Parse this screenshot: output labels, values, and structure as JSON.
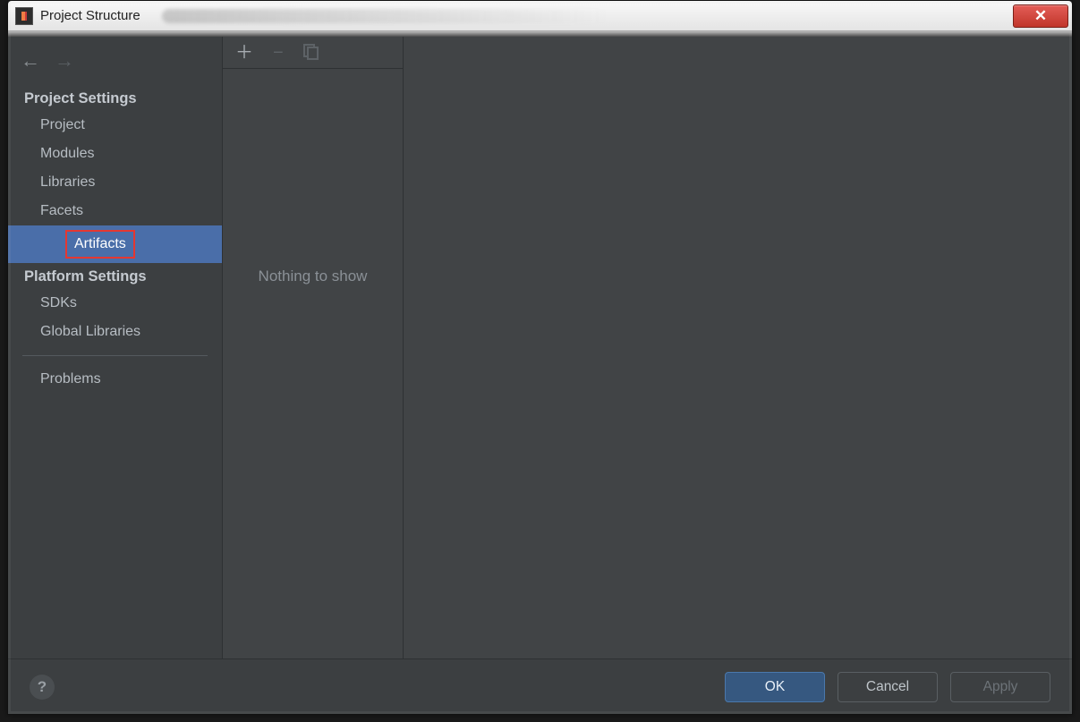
{
  "window": {
    "title": "Project Structure"
  },
  "sidebar": {
    "section1": "Project Settings",
    "items1": {
      "project": "Project",
      "modules": "Modules",
      "libraries": "Libraries",
      "facets": "Facets",
      "artifacts": "Artifacts"
    },
    "section2": "Platform Settings",
    "items2": {
      "sdks": "SDKs",
      "global_libraries": "Global Libraries"
    },
    "problems": "Problems"
  },
  "midcol": {
    "empty_text": "Nothing to show"
  },
  "footer": {
    "ok": "OK",
    "cancel": "Cancel",
    "apply": "Apply",
    "help": "?"
  }
}
